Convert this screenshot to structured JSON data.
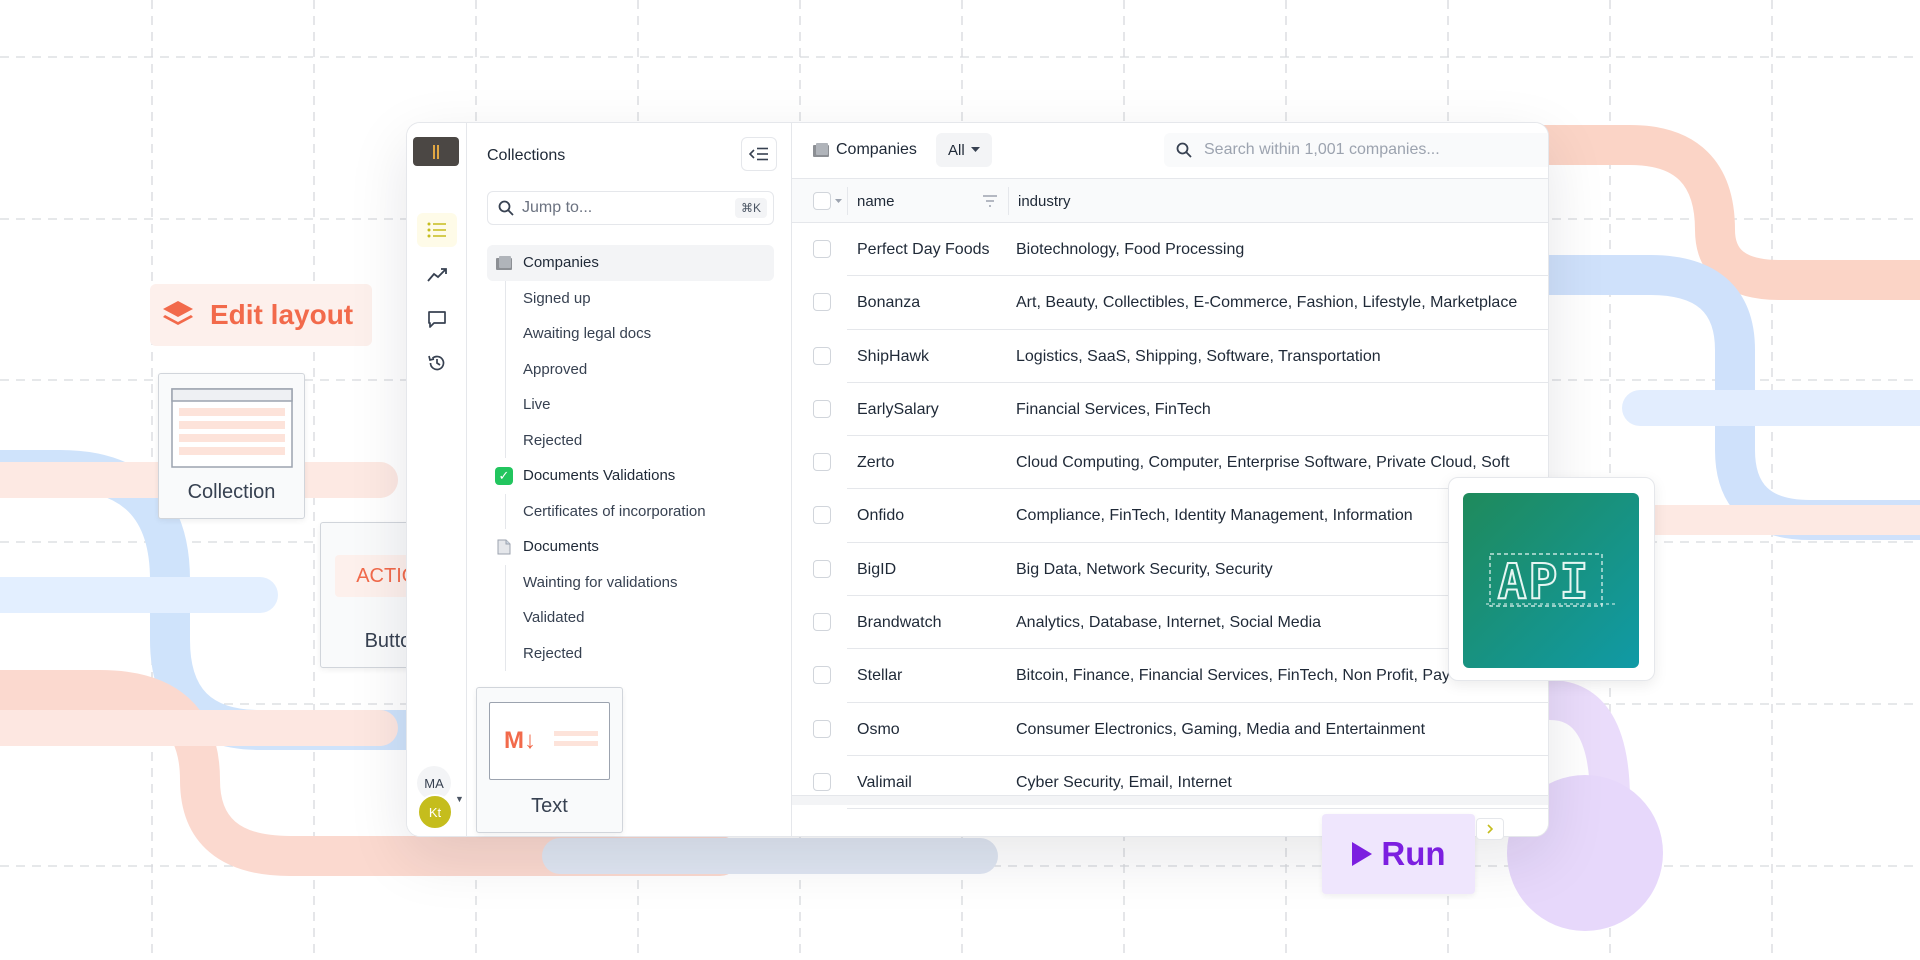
{
  "sidebar": {
    "avatars": [
      "MA",
      "Kt"
    ],
    "icons": [
      "list-icon",
      "chart-icon",
      "comment-icon",
      "history-icon"
    ]
  },
  "nav": {
    "title": "Collections",
    "jump_placeholder": "Jump to...",
    "shortcut": "⌘K",
    "tree": [
      {
        "label": "Companies",
        "type": "folder",
        "selected": true
      },
      {
        "label": "Signed up",
        "type": "child"
      },
      {
        "label": "Awaiting legal docs",
        "type": "child"
      },
      {
        "label": "Approved",
        "type": "child"
      },
      {
        "label": "Live",
        "type": "child"
      },
      {
        "label": "Rejected",
        "type": "child"
      },
      {
        "label": "Documents Validations",
        "type": "check"
      },
      {
        "label": "Certificates of incorporation",
        "type": "child"
      },
      {
        "label": "Documents",
        "type": "doc"
      },
      {
        "label": "Wainting for validations",
        "type": "child"
      },
      {
        "label": "Validated",
        "type": "child"
      },
      {
        "label": "Rejected",
        "type": "child"
      }
    ]
  },
  "main": {
    "collection_name": "Companies",
    "filter_label": "All",
    "search_placeholder": "Search within 1,001 companies...",
    "columns": [
      "name",
      "industry"
    ],
    "rows": [
      {
        "name": "Perfect Day Foods",
        "industry": "Biotechnology, Food Processing"
      },
      {
        "name": "Bonanza",
        "industry": "Art, Beauty, Collectibles, E-Commerce, Fashion, Lifestyle, Marketplace"
      },
      {
        "name": "ShipHawk",
        "industry": "Logistics, SaaS, Shipping, Software, Transportation"
      },
      {
        "name": "EarlySalary",
        "industry": "Financial Services, FinTech"
      },
      {
        "name": "Zerto",
        "industry": "Cloud Computing, Computer, Enterprise Software, Private Cloud, Soft"
      },
      {
        "name": "Onfido",
        "industry": "Compliance, FinTech, Identity Management, Information"
      },
      {
        "name": "BigID",
        "industry": "Big Data, Network Security, Security"
      },
      {
        "name": "Brandwatch",
        "industry": "Analytics, Database, Internet, Social Media"
      },
      {
        "name": "Stellar",
        "industry": "Bitcoin, Finance, Financial Services, FinTech, Non Profit, Pay"
      },
      {
        "name": "Osmo",
        "industry": "Consumer Electronics, Gaming, Media and Entertainment"
      },
      {
        "name": "Valimail",
        "industry": "Cyber Security, Email, Internet"
      }
    ]
  },
  "overlays": {
    "edit_layout": "Edit layout",
    "collection_card": "Collection",
    "action_label": "ACTION",
    "button_card": "Button",
    "markdown_badge": "M↓",
    "text_card": "Text",
    "api_label": "API",
    "run_label": "Run"
  },
  "colors": {
    "accent_orange": "#f26a4b",
    "accent_purple": "#7c1fe0",
    "accent_yellow": "#c5bd1d",
    "api_green": "#1f8a5b",
    "api_teal": "#109aa6"
  }
}
